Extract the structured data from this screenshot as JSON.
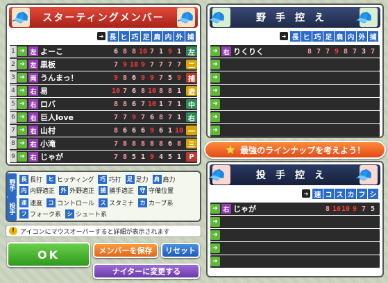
{
  "starting": {
    "title": "スターティングメンバー",
    "columns": [
      "長",
      "ヒ",
      "巧",
      "足",
      "肩",
      "内",
      "外",
      "捕"
    ],
    "players": [
      {
        "no": "1",
        "hand": "左",
        "name": "よーこ",
        "stats": [
          "6",
          "8",
          "8",
          "10",
          "7",
          "1",
          "9",
          "1"
        ],
        "pos": "左",
        "pos_color": "#2e8b57"
      },
      {
        "no": "2",
        "hand": "左",
        "name": "黒板",
        "stats": [
          "7",
          "9",
          "10",
          "9",
          "7",
          "7",
          "7",
          "7"
        ],
        "pos": "二",
        "pos_color": "#d9a400"
      },
      {
        "no": "3",
        "hand": "両",
        "name": "うんまっ！",
        "stats": [
          "9",
          "8",
          "6",
          "9",
          "9",
          "7",
          "5",
          "9"
        ],
        "pos": "捕",
        "pos_color": "#c0392b"
      },
      {
        "no": "4",
        "hand": "右",
        "name": "易",
        "stats": [
          "10",
          "7",
          "6",
          "8",
          "10",
          "8",
          "8",
          "1"
        ],
        "pos": "遊",
        "pos_color": "#d9a400"
      },
      {
        "no": "5",
        "hand": "右",
        "name": "ロバ",
        "stats": [
          "8",
          "8",
          "6",
          "7",
          "10",
          "1",
          "7",
          "1"
        ],
        "pos": "中",
        "pos_color": "#2e8b57"
      },
      {
        "no": "6",
        "hand": "右",
        "name": "巨人love",
        "stats": [
          "7",
          "7",
          "9",
          "7",
          "6",
          "8",
          "7",
          "1"
        ],
        "pos": "右",
        "pos_color": "#2e8b57"
      },
      {
        "no": "7",
        "hand": "右",
        "name": "山村",
        "stats": [
          "8",
          "6",
          "6",
          "6",
          "9",
          "6",
          "1",
          "10"
        ],
        "pos": "一",
        "pos_color": "#d9a400"
      },
      {
        "no": "8",
        "hand": "右",
        "name": "小滝",
        "stats": [
          "7",
          "8",
          "8",
          "8",
          "8",
          "8",
          "6",
          "8"
        ],
        "pos": "三",
        "pos_color": "#d9a400"
      },
      {
        "no": "9",
        "hand": "右",
        "name": "じゃが",
        "stats": [
          "7",
          "8",
          "5",
          "1",
          "9",
          "4",
          "5",
          "1"
        ],
        "pos": "P",
        "pos_color": "#c0392b"
      }
    ]
  },
  "bench_fielders": {
    "title": "野手控え",
    "columns": [
      "長",
      "ヒ",
      "巧",
      "足",
      "肩",
      "内",
      "外",
      "捕"
    ],
    "players": [
      {
        "hand": "右",
        "name": "りくりく",
        "stats": [
          "8",
          "7",
          "7",
          "9",
          "8",
          "7",
          "3",
          "7"
        ]
      }
    ],
    "empty_slots": 6
  },
  "banner": {
    "text": "最強のラインナップを考えよう！"
  },
  "bench_pitchers": {
    "title": "投手控え",
    "columns": [
      "速",
      "コ",
      "ス",
      "カ",
      "フ",
      "シ"
    ],
    "players": [
      {
        "hand": "右",
        "name": "じゃが",
        "stats": [
          "8",
          "10",
          "10",
          "9",
          "7",
          "5"
        ]
      }
    ],
    "empty_slots": 4
  },
  "legend": {
    "fielder_cat": "野手",
    "pitcher_cat": "投手",
    "fielder_row1": [
      {
        "tag": "長",
        "text": "長打"
      },
      {
        "tag": "ヒ",
        "text": "ヒッティング"
      },
      {
        "tag": "巧",
        "text": "巧打"
      },
      {
        "tag": "足",
        "text": "足力"
      },
      {
        "tag": "肩",
        "text": "肩力"
      }
    ],
    "fielder_row2": [
      {
        "tag": "内",
        "text": "内野適正"
      },
      {
        "tag": "外",
        "text": "外野適正"
      },
      {
        "tag": "捕",
        "text": "捕手適正"
      },
      {
        "tag": "守",
        "text": "守備位置"
      }
    ],
    "pitcher_row1": [
      {
        "tag": "速",
        "text": "速度"
      },
      {
        "tag": "コ",
        "text": "コントロール"
      },
      {
        "tag": "ス",
        "text": "スタミナ"
      },
      {
        "tag": "カ",
        "text": "カーブ系"
      }
    ],
    "pitcher_row2": [
      {
        "tag": "フ",
        "text": "フォーク系"
      },
      {
        "tag": "シ",
        "text": "シュート系"
      }
    ]
  },
  "info": {
    "icon": "!",
    "text": "アイコンにマウスオーバーすると詳細が表示されます"
  },
  "buttons": {
    "ok": "OK",
    "save": "メンバーを保存",
    "reset": "リセット",
    "night": "ナイターに変更する"
  }
}
